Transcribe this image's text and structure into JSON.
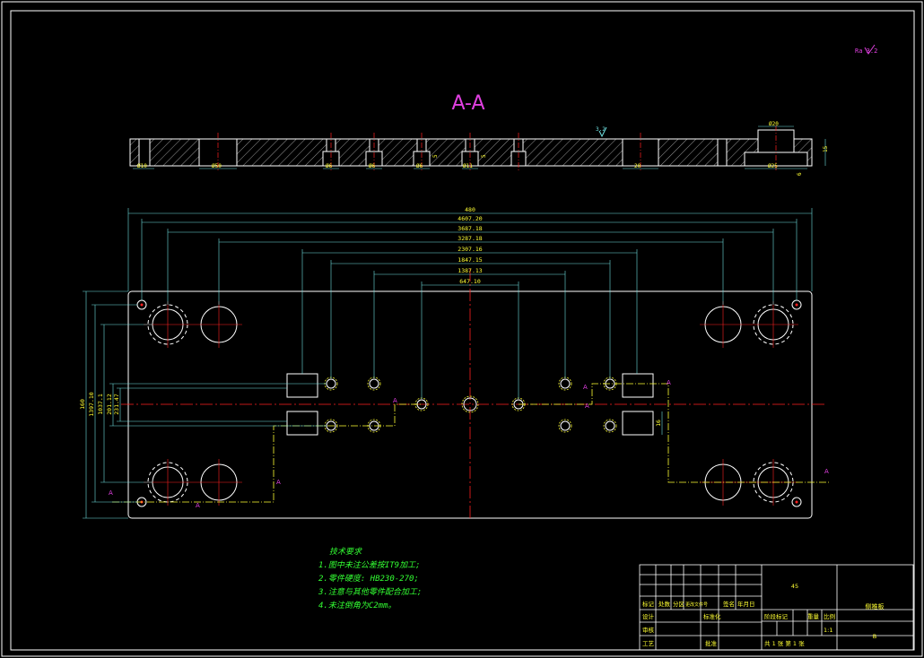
{
  "section_label": "A-A",
  "roughness": {
    "default_symbol": "Ra 3.2",
    "top_mark": "3.2"
  },
  "section_dims": {
    "thickness": "15",
    "dims_bottom": [
      "Ø10",
      "Ø50",
      "Ø6",
      "Ø6",
      "Ø6",
      "Ø11",
      "20",
      "Ø25"
    ],
    "dims_right": [
      "5",
      "5",
      "6"
    ],
    "dim_top": "Ø20"
  },
  "horizontal_dims": [
    "480",
    "4607.20",
    "3687.18",
    "3287.18",
    "2307.16",
    "1847.15",
    "1387.13",
    "647.10"
  ],
  "vertical_dims_left": [
    "160",
    "1397.10",
    "1037.1",
    "201.12",
    "231.47"
  ],
  "vertical_dim_right": "16",
  "section_marks": [
    "A",
    "A",
    "A",
    "A",
    "A",
    "A",
    "A",
    "A"
  ],
  "tech_notes": {
    "title": "技术要求",
    "items": [
      "1.图中未注公差按IT9加工;",
      "2.零件硬度: HB230-270;",
      "3.注意与其他零件配合加工;",
      "4.未注倒角为C2mm。"
    ]
  },
  "title_block": {
    "material": "45",
    "part_name": "侧推板",
    "scale_value": "1:1",
    "sheet_text": "共 1 张 第 1 张",
    "code": "B",
    "headers_row": [
      "标记",
      "处数",
      "分区",
      "更改文件号",
      "签名",
      "年月日"
    ],
    "side_labels": [
      "设计",
      "审核",
      "工艺"
    ],
    "mid_labels": [
      "标准化",
      "批准"
    ],
    "stage_labels": [
      "阶段标记",
      "重量",
      "比例"
    ]
  },
  "colors": {
    "frame": "#ffffff",
    "outline": "#ffffff",
    "centerline": "#ff2020",
    "dimension": "#6fe0e0",
    "dim_text": "#ffff33",
    "hatch": "#ffffff",
    "section_label": "#e040e0",
    "notes": "#33ff33",
    "table_text": "#ffff33"
  }
}
